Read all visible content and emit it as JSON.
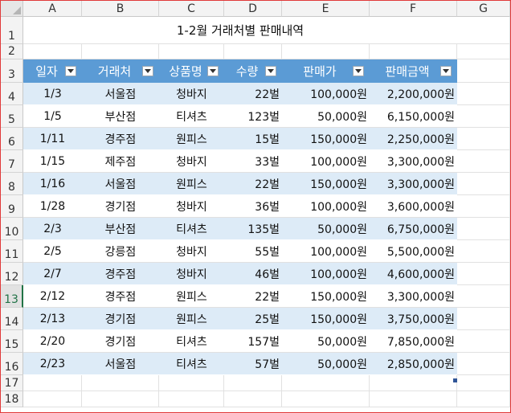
{
  "columns": [
    "A",
    "B",
    "C",
    "D",
    "E",
    "F",
    "G"
  ],
  "rows": [
    "1",
    "2",
    "3",
    "4",
    "5",
    "6",
    "7",
    "8",
    "9",
    "10",
    "11",
    "12",
    "13",
    "14",
    "15",
    "16",
    "17",
    "18"
  ],
  "selected_row": "13",
  "title": "1-2월 거래처별 판매내역",
  "headers": [
    "일자",
    "거래처",
    "상품명",
    "수량",
    "판매가",
    "판매금액"
  ],
  "table": [
    [
      "1/3",
      "서울점",
      "청바지",
      "22벌",
      "100,000원",
      "2,200,000원"
    ],
    [
      "1/5",
      "부산점",
      "티셔츠",
      "123벌",
      "50,000원",
      "6,150,000원"
    ],
    [
      "1/11",
      "경주점",
      "원피스",
      "15벌",
      "150,000원",
      "2,250,000원"
    ],
    [
      "1/15",
      "제주점",
      "청바지",
      "33벌",
      "100,000원",
      "3,300,000원"
    ],
    [
      "1/16",
      "서울점",
      "원피스",
      "22벌",
      "150,000원",
      "3,300,000원"
    ],
    [
      "1/28",
      "경기점",
      "청바지",
      "36벌",
      "100,000원",
      "3,600,000원"
    ],
    [
      "2/3",
      "부산점",
      "티셔츠",
      "135벌",
      "50,000원",
      "6,750,000원"
    ],
    [
      "2/5",
      "강릉점",
      "청바지",
      "55벌",
      "100,000원",
      "5,500,000원"
    ],
    [
      "2/7",
      "경주점",
      "청바지",
      "46벌",
      "100,000원",
      "4,600,000원"
    ],
    [
      "2/12",
      "경주점",
      "원피스",
      "22벌",
      "150,000원",
      "3,300,000원"
    ],
    [
      "2/13",
      "경기점",
      "원피스",
      "25벌",
      "150,000원",
      "3,750,000원"
    ],
    [
      "2/20",
      "경기점",
      "티셔츠",
      "157벌",
      "50,000원",
      "7,850,000원"
    ],
    [
      "2/23",
      "서울점",
      "티셔츠",
      "57벌",
      "50,000원",
      "2,850,000원"
    ]
  ],
  "colors": {
    "header_bg": "#5b9bd5",
    "band_bg": "#ddebf7",
    "selection": "#217346",
    "frame_border": "#e03a3a"
  },
  "icons": {
    "filter": "filter-dropdown-icon"
  }
}
